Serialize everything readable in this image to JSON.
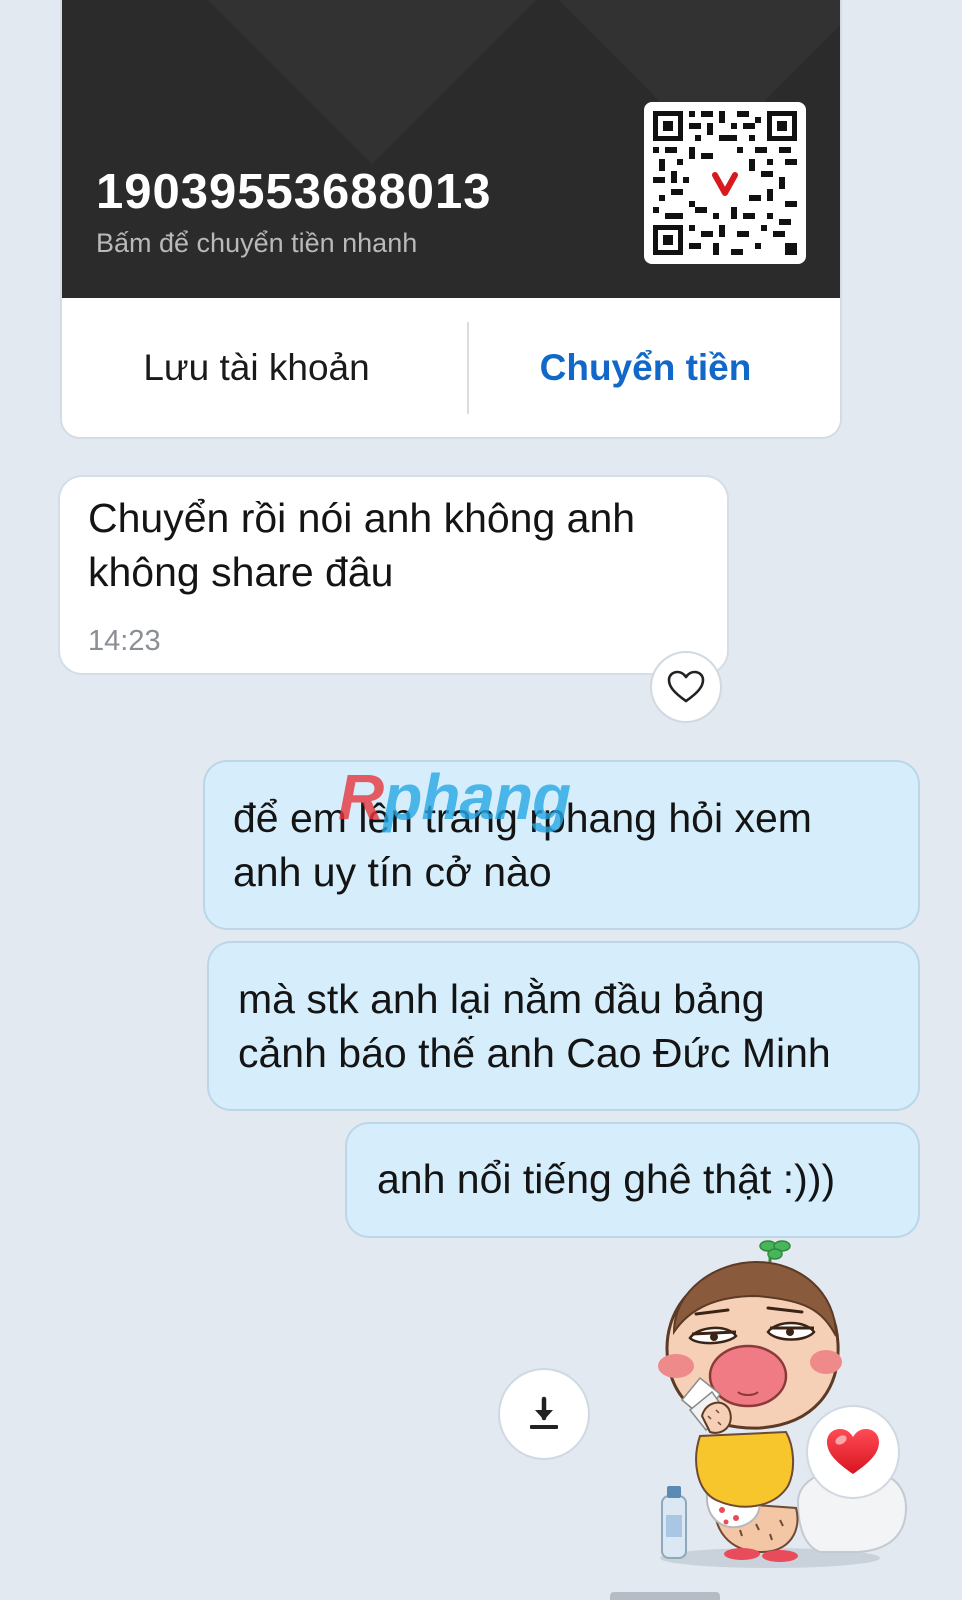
{
  "bank_card": {
    "account_number": "19039553688013",
    "hint": "Bấm để chuyển tiền nhanh",
    "save_label": "Lưu tài khoản",
    "transfer_label": "Chuyển tiền",
    "qr_badge_letter": "V",
    "qr_badge_color": "#d71920"
  },
  "messages": [
    {
      "direction": "incoming",
      "lines": [
        "Chuyển rồi nói anh không anh",
        "không share đâu"
      ],
      "time": "14:23",
      "reaction_icon": "heart-outline-icon"
    },
    {
      "direction": "outgoing",
      "lines": [
        "để em lên trang rphang hỏi xem",
        "anh uy tín cở nào"
      ]
    },
    {
      "direction": "outgoing",
      "lines": [
        "mà stk anh lại nằm đầu bảng",
        "cảnh báo thế anh Cao Đức Minh"
      ]
    },
    {
      "direction": "outgoing",
      "lines": [
        "anh nổi tiếng ghê thật :)))"
      ]
    }
  ],
  "watermark": {
    "first": "R",
    "rest": "phang"
  },
  "sticker": {
    "icon": "cartoon-boy-sticker",
    "reaction_icon": "red-heart-icon",
    "download_icon": "download-icon"
  },
  "colors": {
    "background": "#e2e9f1",
    "card_dark": "#2b2b2b",
    "accent_blue": "#1168c8",
    "outgoing_bubble": "#d6eefb",
    "incoming_bubble": "#ffffff"
  }
}
